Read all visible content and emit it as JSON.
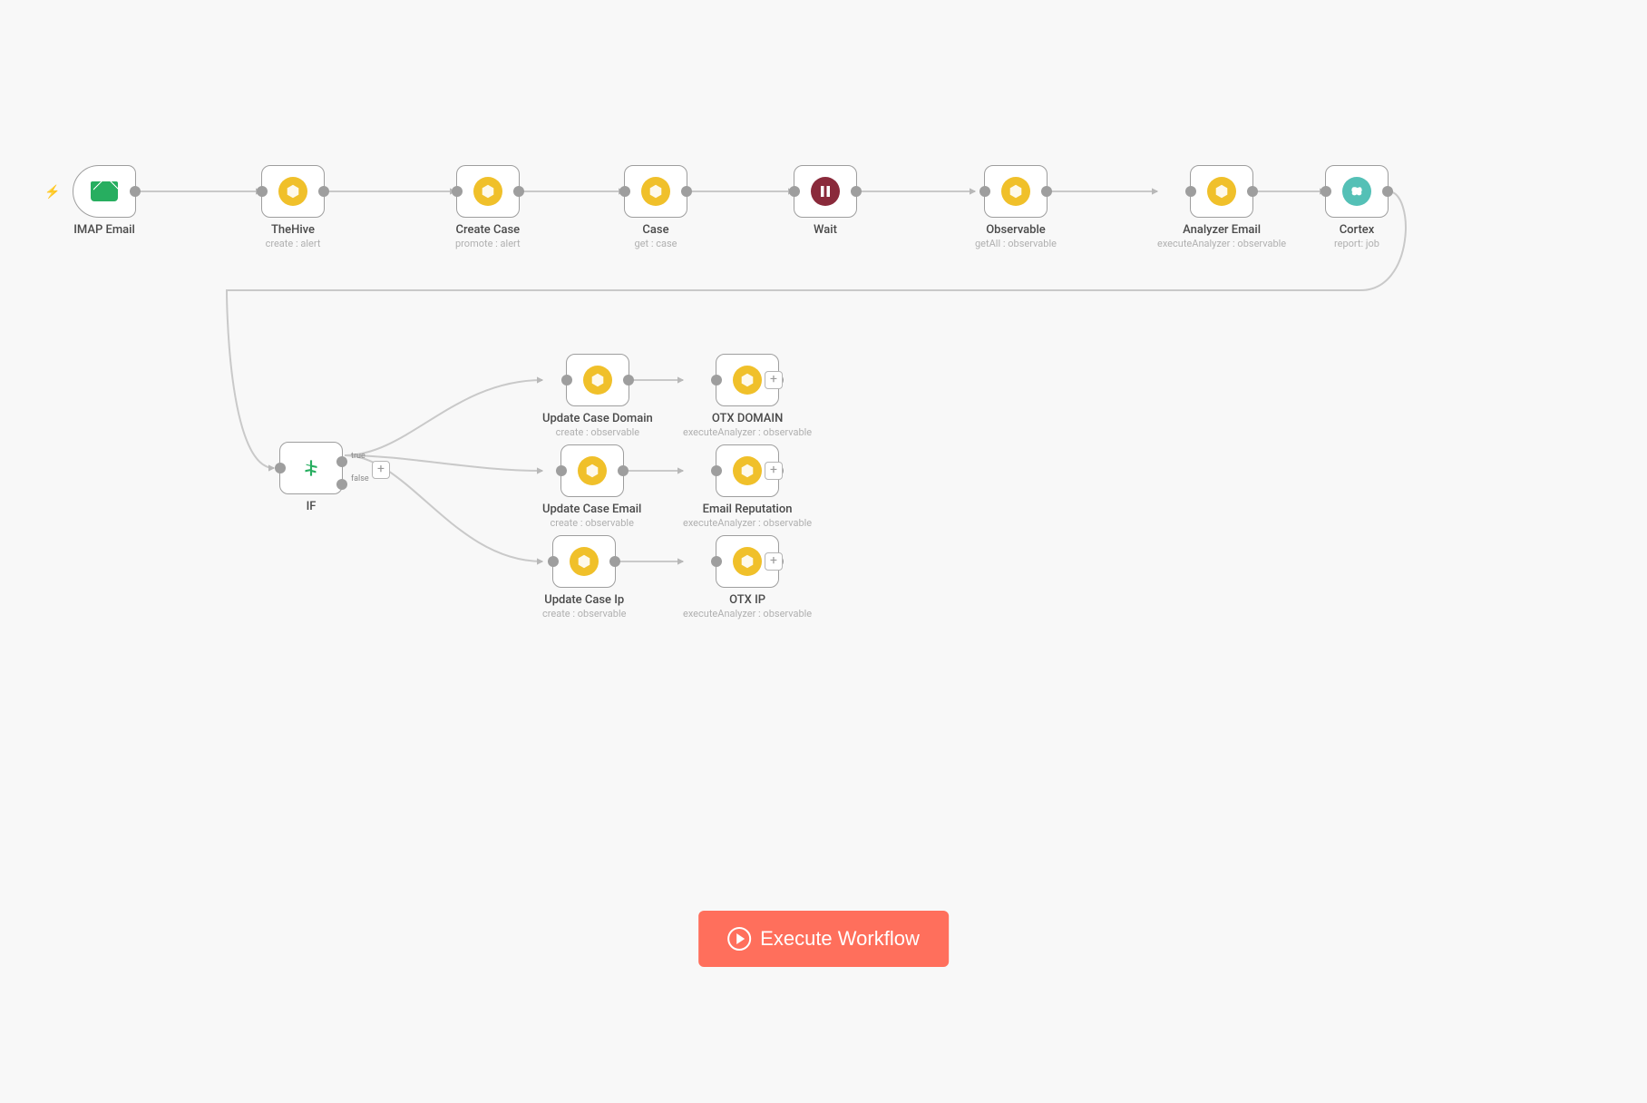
{
  "colors": {
    "accent": "#ff6f5c",
    "hive": "#f0c02a",
    "wait": "#8a2a3b",
    "cortex": "#54c0b6",
    "email": "#27ae60"
  },
  "execute_label": "Execute Workflow",
  "nodes": {
    "imap_email": {
      "title": "IMAP Email",
      "subtitle": ""
    },
    "thehive": {
      "title": "TheHive",
      "subtitle": "create : alert"
    },
    "create_case": {
      "title": "Create Case",
      "subtitle": "promote : alert"
    },
    "case": {
      "title": "Case",
      "subtitle": "get : case"
    },
    "wait": {
      "title": "Wait",
      "subtitle": ""
    },
    "observable": {
      "title": "Observable",
      "subtitle": "getAll : observable"
    },
    "analyzer_email": {
      "title": "Analyzer Email",
      "subtitle": "executeAnalyzer : observable"
    },
    "cortex": {
      "title": "Cortex",
      "subtitle": "report: job"
    },
    "if": {
      "title": "IF",
      "subtitle": "",
      "port_true": "true",
      "port_false": "false"
    },
    "update_domain": {
      "title": "Update Case Domain",
      "subtitle": "create : observable"
    },
    "otx_domain": {
      "title": "OTX DOMAIN",
      "subtitle": "executeAnalyzer : observable"
    },
    "update_email": {
      "title": "Update Case Email",
      "subtitle": "create : observable"
    },
    "email_rep": {
      "title": "Email Reputation",
      "subtitle": "executeAnalyzer : observable"
    },
    "update_ip": {
      "title": "Update Case Ip",
      "subtitle": "create : observable"
    },
    "otx_ip": {
      "title": "OTX IP",
      "subtitle": "executeAnalyzer : observable"
    }
  },
  "add_symbol": "+"
}
